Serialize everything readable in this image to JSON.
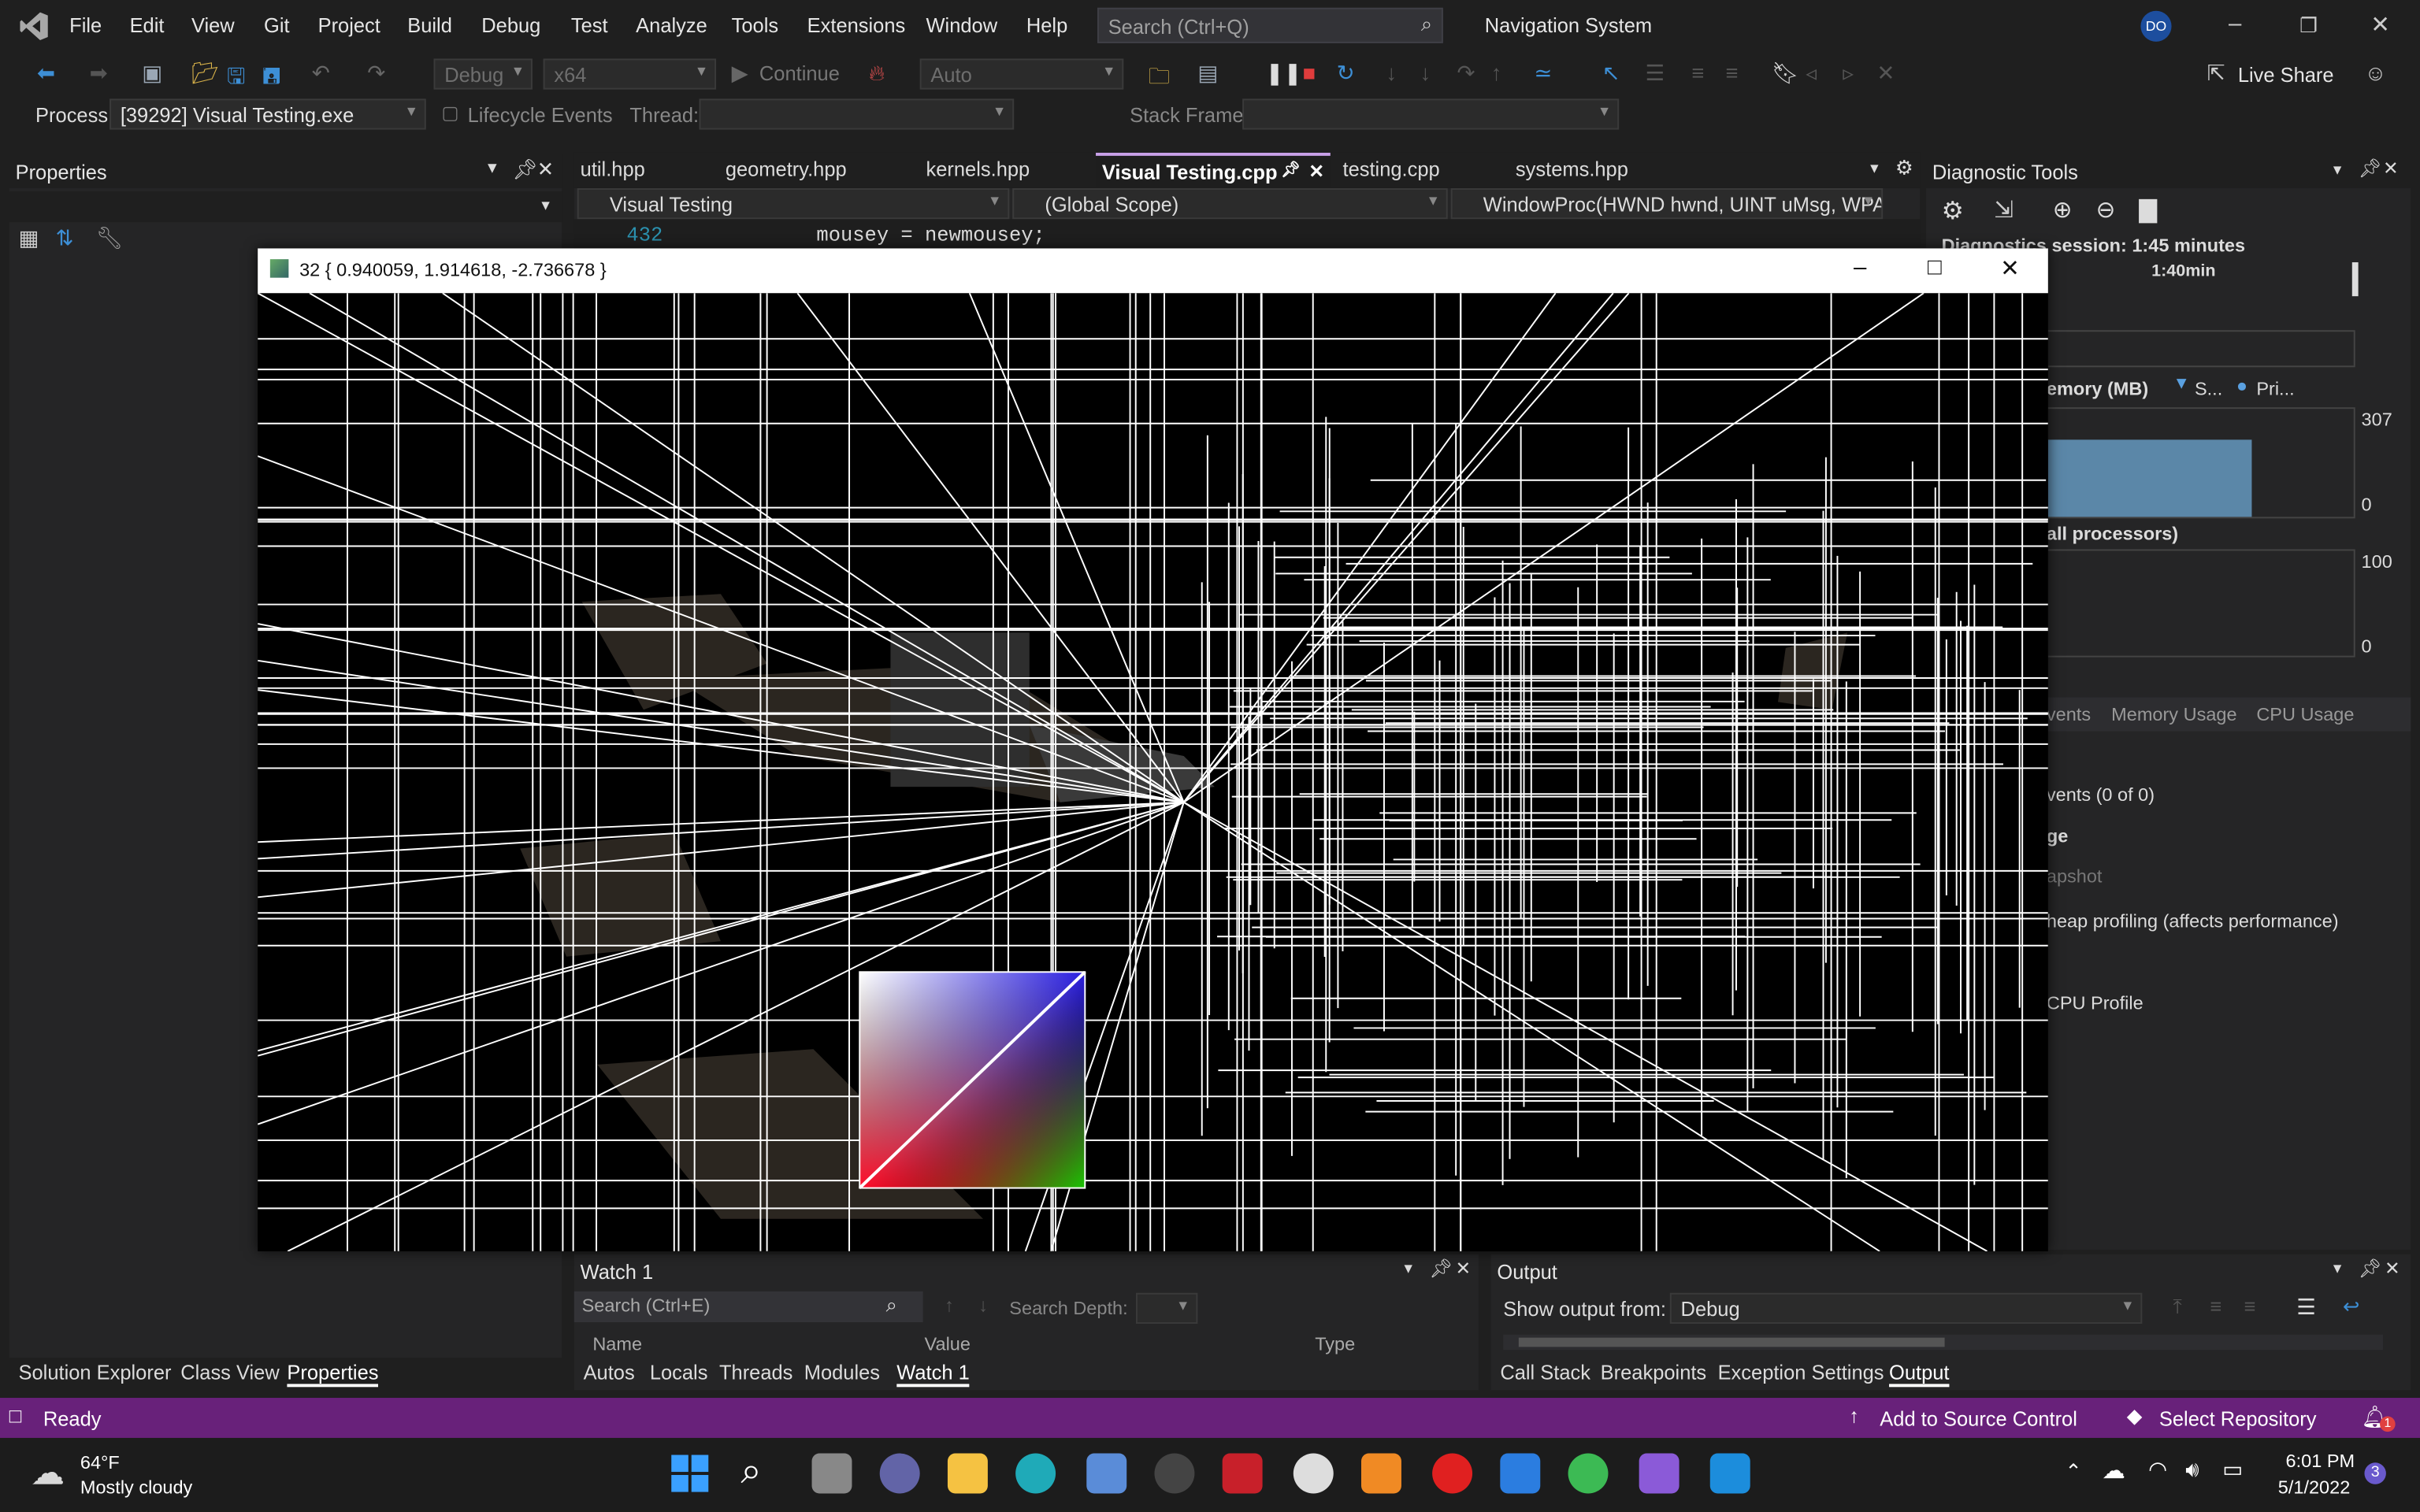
{
  "menu": {
    "items": [
      "File",
      "Edit",
      "View",
      "Git",
      "Project",
      "Build",
      "Debug",
      "Test",
      "Analyze",
      "Tools",
      "Extensions",
      "Window",
      "Help"
    ],
    "search_placeholder": "Search (Ctrl+Q)",
    "solution_name": "Navigation System",
    "user_initials": "DO"
  },
  "toolbar": {
    "config": "Debug",
    "platform": "x64",
    "continue_label": "Continue",
    "auto_label": "Auto",
    "live_share": "Live Share"
  },
  "debug_bar": {
    "process_label": "Process:",
    "process_value": "[39292] Visual Testing.exe",
    "lifecycle_label": "Lifecycle Events",
    "thread_label": "Thread:",
    "stack_frame_label": "Stack Frame:"
  },
  "properties": {
    "title": "Properties"
  },
  "editor": {
    "tabs": [
      "util.hpp",
      "geometry.hpp",
      "kernels.hpp",
      "Visual Testing.cpp",
      "testing.cpp",
      "systems.hpp"
    ],
    "active_tab": "Visual Testing.cpp",
    "project_scope": "Visual Testing",
    "global_scope": "(Global Scope)",
    "function_scope": "WindowProc(HWND hwnd, UINT uMsg, WPAR",
    "line_number": "432",
    "code_line": "mousey = newmousey;"
  },
  "diagnostic": {
    "title": "Diagnostic Tools",
    "session": "Diagnostics session: 1:45 minutes",
    "timeline_label": "1:40min",
    "memory_title": "emory (MB)",
    "legend_s": "S...",
    "legend_p": "Pri...",
    "memory_max": "307",
    "memory_min": "0",
    "cpu_title": "all processors)",
    "cpu_max": "100",
    "cpu_min": "0",
    "tabs": [
      "vents",
      "Memory Usage",
      "CPU Usage"
    ],
    "rows": [
      "vents (0 of 0)",
      "ge",
      "apshot",
      "heap profiling (affects performance)",
      "CPU Profile"
    ]
  },
  "render_window": {
    "title": "32 { 0.940059, 1.914618, -2.736678 }"
  },
  "watch": {
    "title": "Watch 1",
    "search_placeholder": "Search (Ctrl+E)",
    "search_depth": "Search Depth:",
    "col_name": "Name",
    "col_value": "Value",
    "col_type": "Type",
    "tabs": [
      "Autos",
      "Locals",
      "Threads",
      "Modules",
      "Watch 1"
    ]
  },
  "output": {
    "title": "Output",
    "show_from_label": "Show output from:",
    "show_from_value": "Debug",
    "tabs": [
      "Call Stack",
      "Breakpoints",
      "Exception Settings",
      "Output"
    ]
  },
  "left_tabs": [
    "Solution Explorer",
    "Class View",
    "Properties"
  ],
  "status": {
    "text": "Ready",
    "source_control": "Add to Source Control",
    "repository": "Select Repository",
    "notifications": "1"
  },
  "taskbar": {
    "temp": "64°F",
    "weather": "Mostly cloudy",
    "time": "6:01 PM",
    "date": "5/1/2022",
    "badge": "3"
  },
  "colors": {
    "accent": "#68217a",
    "background": "#1f1f1f",
    "panel": "#252526",
    "active_tab": "#1f1f1f"
  }
}
